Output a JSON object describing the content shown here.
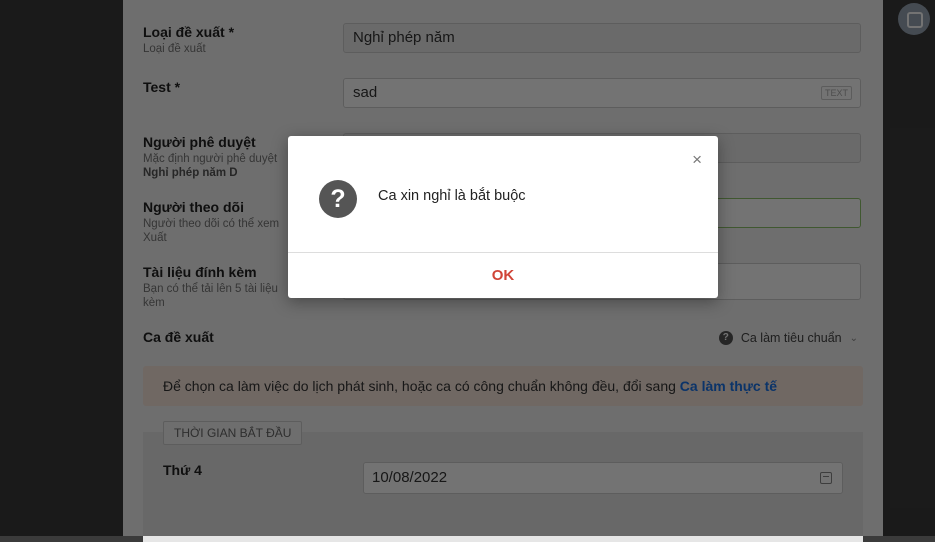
{
  "form": {
    "type_label": "Loại đề xuất *",
    "type_sub": "Loại đề xuất",
    "type_value": "Nghỉ phép năm",
    "test_label": "Test *",
    "test_value": "sad",
    "test_tag": "TEXT",
    "approver_label": "Người phê duyệt",
    "approver_sub": "Mặc định người phê duyệt",
    "approver_sub_bold": "Nghỉ phép năm D",
    "follower_label": "Người theo dõi",
    "follower_sub": "Người theo dõi có thể xem",
    "follower_sub2": "Xuất",
    "attach_label": "Tài liệu đính kèm",
    "attach_sub": "Bạn có thể tải lên 5 tài liệu",
    "attach_sub2": "kèm",
    "shift_label": "Ca đề xuất",
    "shift_select": "Ca làm tiêu chuẩn",
    "note_text": "Để chọn ca làm việc do lịch phát sinh, hoặc ca có công chuẩn không đều, đổi sang ",
    "note_link": "Ca làm thực tế",
    "start_legend": "THỜI GIAN BẮT ĐẦU",
    "day_label": "Thứ 4",
    "date_value": "10/08/2022"
  },
  "dialog": {
    "message": "Ca xin nghỉ là bắt buộc",
    "ok_label": "OK",
    "close_glyph": "×",
    "icon_glyph": "?"
  },
  "colors": {
    "ok": "#d04437",
    "link": "#1a73e8",
    "note_bg": "#f8e6dc"
  }
}
